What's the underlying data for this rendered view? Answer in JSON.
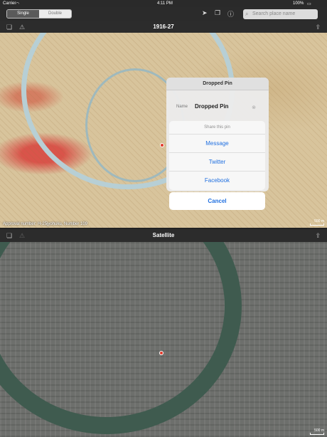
{
  "status": {
    "carrier": "Carrier",
    "time": "4:11 PM",
    "battery": "100%"
  },
  "nav": {
    "seg_single": "Single",
    "seg_double": "Double",
    "search_placeholder": "Search place name"
  },
  "top_map": {
    "title": "1916-27",
    "caption": "Approval number: H-25jyohuku, Number 109",
    "scale": "500 m"
  },
  "popover": {
    "title": "Dropped Pin",
    "name_label": "Name",
    "name_value": "Dropped Pin"
  },
  "share_sheet": {
    "title": "Share this pin",
    "options": [
      "Message",
      "Twitter",
      "Facebook"
    ],
    "cancel": "Cancel"
  },
  "bottom_map": {
    "title": "Satellite",
    "scale": "500 m"
  },
  "colors": {
    "accent": "#1f6fe0",
    "pin": "#e23b2c"
  }
}
